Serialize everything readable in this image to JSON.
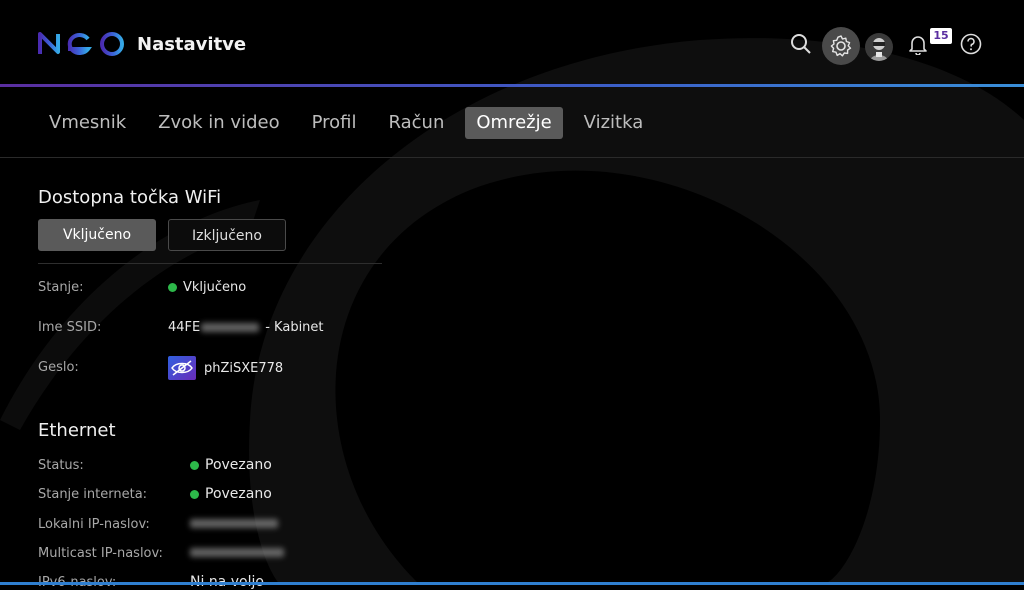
{
  "header": {
    "logo_text": "NEO",
    "title": "Nastavitve",
    "notifications_count": "15",
    "icons": [
      "search-icon",
      "gear-icon",
      "avatar",
      "bell-icon",
      "help-icon"
    ]
  },
  "tabs": [
    {
      "label": "Vmesnik",
      "active": false
    },
    {
      "label": "Zvok in video",
      "active": false
    },
    {
      "label": "Profil",
      "active": false
    },
    {
      "label": "Račun",
      "active": false
    },
    {
      "label": "Omrežje",
      "active": true
    },
    {
      "label": "Vizitka",
      "active": false
    }
  ],
  "wifi": {
    "title": "Dostopna točka WiFi",
    "toggle_on": "Vključeno",
    "toggle_off": "Izključeno",
    "state_label": "Stanje:",
    "state_value": "Vključeno",
    "ssid_label": "Ime SSID:",
    "ssid_prefix": "44FE",
    "ssid_suffix": "- Kabinet",
    "password_label": "Geslo:",
    "password_value": "phZiSXE778"
  },
  "ethernet": {
    "title": "Ethernet",
    "status_label": "Status:",
    "status_value": "Povezano",
    "internet_label": "Stanje interneta:",
    "internet_value": "Povezano",
    "local_ip_label": "Lokalni IP-naslov:",
    "multicast_ip_label": "Multicast IP-naslov:",
    "ipv6_label": "IPv6-naslov:",
    "ipv6_value": "Ni na voljo"
  },
  "colors": {
    "accent_purple": "#5a2ea0",
    "accent_blue": "#3a8fd8",
    "status_green": "#2db84a"
  }
}
